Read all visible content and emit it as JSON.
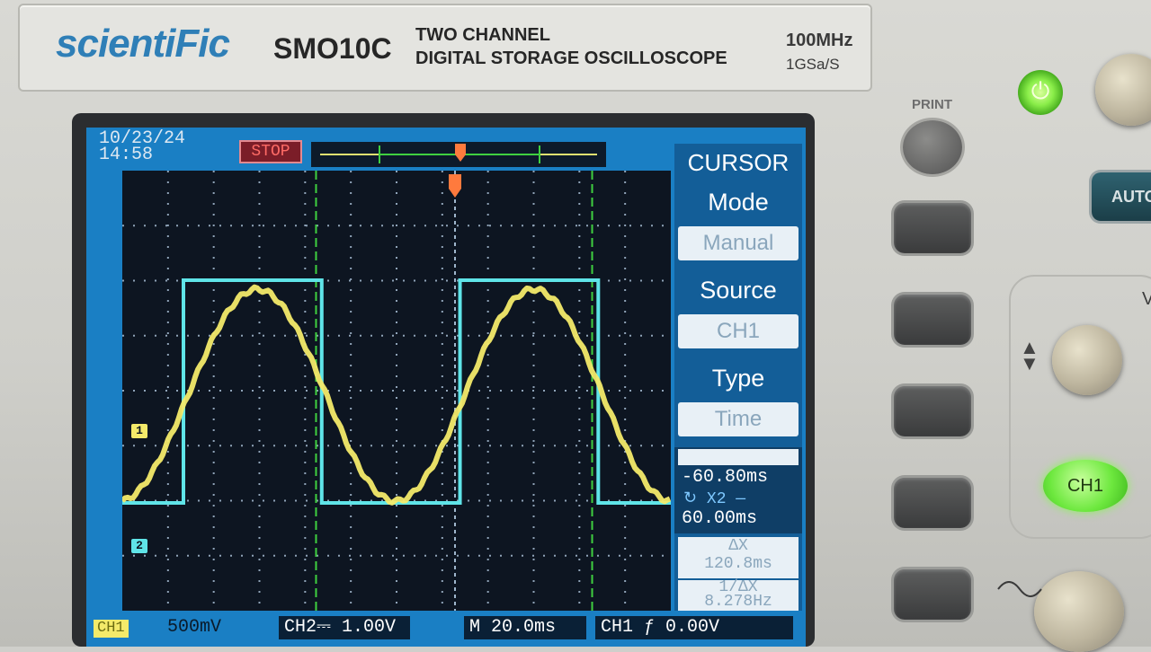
{
  "device": {
    "brand": "scientiFic",
    "model": "SMO10C",
    "description_line1": "TWO CHANNEL",
    "description_line2": "DIGITAL STORAGE OSCILLOSCOPE",
    "bandwidth": "100MHz",
    "sample_rate": "1GSa/S"
  },
  "screen": {
    "date": "10/23/24",
    "time": "14:58",
    "run_state": "STOP",
    "trigger_marker": "T",
    "channel1_marker": "1",
    "channel2_marker": "2"
  },
  "menu": {
    "title": "CURSOR",
    "items": [
      {
        "header": "Mode",
        "value": "Manual"
      },
      {
        "header": "Source",
        "value": "CH1"
      },
      {
        "header": "Type",
        "value": "Time"
      }
    ],
    "x1_value": "-60.80ms",
    "x2_label": "X2",
    "x2_value": "60.00ms",
    "delta_label": "ΔX",
    "delta_x": "120.8ms",
    "inv_delta_label": "1/ΔX",
    "inv_delta_x": "8.278Hz"
  },
  "status_bar": {
    "ch1_badge": "CH1",
    "ch1_scale": "500mV",
    "ch2_label": "CH2",
    "ch2_scale": "1.00V",
    "timebase_label": "M",
    "timebase": "20.0ms",
    "trigger_source": "CH1",
    "trigger_level": "0.00V"
  },
  "controls": {
    "print_label": "PRINT",
    "auto_label": "AUTO",
    "ch1_button_label": "CH1",
    "volts_label": "V"
  },
  "colors": {
    "screen_bg": "#1a7fc4",
    "grid_bg": "#0d1521",
    "ch1_trace": "#f4ea6a",
    "ch2_trace": "#5fe4e8",
    "cursor": "#3fd040",
    "trigger": "#ff7a3d",
    "power_led": "#8bee4a"
  },
  "waveform": {
    "ch1": {
      "shape": "sine",
      "period_ms": 121,
      "peak_divisions": 4.8
    },
    "ch2": {
      "shape": "square",
      "period_ms": 121,
      "amplitude_divisions": 4.8
    }
  }
}
